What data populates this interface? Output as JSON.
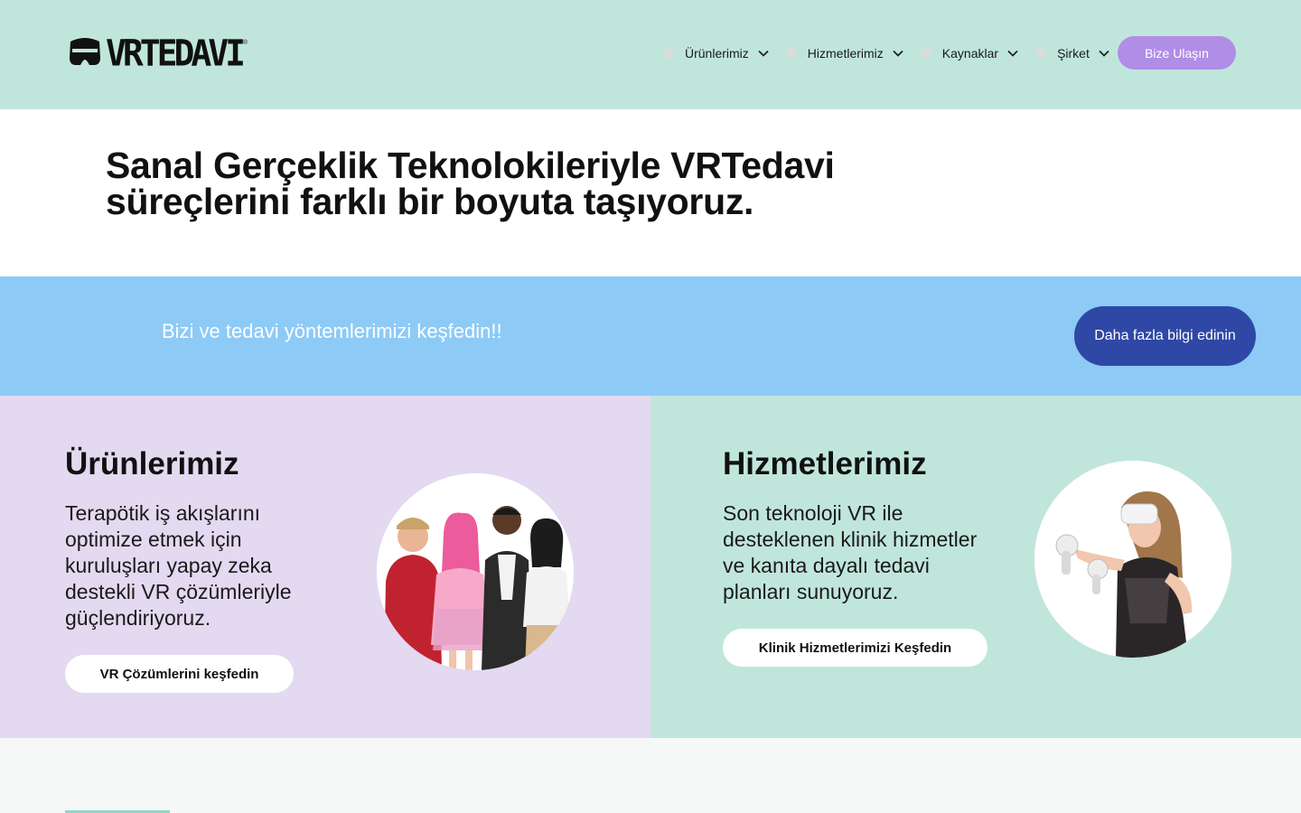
{
  "header": {
    "logo_text": "VRTEDAVI",
    "logo_reg": "®",
    "nav": [
      {
        "label": "Ürünlerimiz"
      },
      {
        "label": "Hizmetlerimiz"
      },
      {
        "label": "Kaynaklar"
      },
      {
        "label": "Şirket"
      }
    ],
    "contact_label": "Bize Ulaşın"
  },
  "hero": {
    "title": "Sanal Gerçeklik Teknolokileriyle VRTedavi süreçlerini farklı bir boyuta taşıyoruz."
  },
  "banner": {
    "text": "Bizi ve tedavi yöntemlerimizi keşfedin!!",
    "button_label": "Daha fazla bilgi edinin"
  },
  "cards": {
    "products": {
      "title": "Ürünlerimiz",
      "description": "Terapötik iş akışlarını optimize etmek için kuruluşları yapay zeka destekli VR çözümleriyle güçlendiriyoruz.",
      "button_label": "VR Çözümlerini keşfedin"
    },
    "services": {
      "title": "Hizmetlerimiz",
      "description": "Son teknoloji VR ile desteklenen klinik hizmetler ve kanıta dayalı tedavi planları sunuyoruz.",
      "button_label": "Klinik Hizmetlerimizi Keşfedin"
    }
  },
  "colors": {
    "header_bg": "#c0e6dc",
    "banner_bg": "#8dcaf6",
    "banner_button": "#2f48a5",
    "contact_button": "#b08ee6",
    "products_bg": "#e3d9f0",
    "services_bg": "#c0e6dc"
  }
}
